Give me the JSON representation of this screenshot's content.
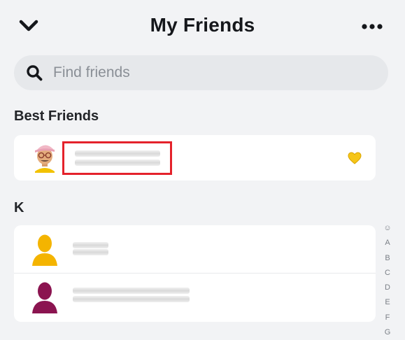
{
  "header": {
    "title": "My Friends",
    "back_icon": "chevron-down-icon",
    "more_icon": "more-horizontal-icon"
  },
  "search": {
    "placeholder": "Find friends",
    "value": ""
  },
  "sections": {
    "best_friends": {
      "label": "Best Friends",
      "friend_badge": "gold-heart-icon"
    },
    "k": {
      "label": "K"
    }
  },
  "alphabet_index": [
    "☺",
    "A",
    "B",
    "C",
    "D",
    "E",
    "F",
    "G"
  ],
  "colors": {
    "background": "#f2f3f5",
    "highlight": "#e4222b",
    "heart": "#f5c518",
    "avatar_yellow": "#f4b400",
    "avatar_maroon": "#8b1450"
  }
}
